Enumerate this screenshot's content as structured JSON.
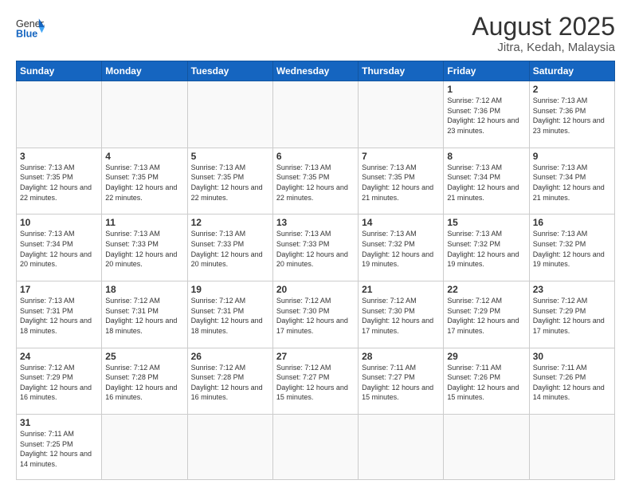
{
  "logo": {
    "text_general": "General",
    "text_blue": "Blue"
  },
  "header": {
    "month_year": "August 2025",
    "location": "Jitra, Kedah, Malaysia"
  },
  "weekdays": [
    "Sunday",
    "Monday",
    "Tuesday",
    "Wednesday",
    "Thursday",
    "Friday",
    "Saturday"
  ],
  "weeks": [
    [
      {
        "day": "",
        "info": ""
      },
      {
        "day": "",
        "info": ""
      },
      {
        "day": "",
        "info": ""
      },
      {
        "day": "",
        "info": ""
      },
      {
        "day": "",
        "info": ""
      },
      {
        "day": "1",
        "info": "Sunrise: 7:12 AM\nSunset: 7:36 PM\nDaylight: 12 hours\nand 23 minutes."
      },
      {
        "day": "2",
        "info": "Sunrise: 7:13 AM\nSunset: 7:36 PM\nDaylight: 12 hours\nand 23 minutes."
      }
    ],
    [
      {
        "day": "3",
        "info": "Sunrise: 7:13 AM\nSunset: 7:35 PM\nDaylight: 12 hours\nand 22 minutes."
      },
      {
        "day": "4",
        "info": "Sunrise: 7:13 AM\nSunset: 7:35 PM\nDaylight: 12 hours\nand 22 minutes."
      },
      {
        "day": "5",
        "info": "Sunrise: 7:13 AM\nSunset: 7:35 PM\nDaylight: 12 hours\nand 22 minutes."
      },
      {
        "day": "6",
        "info": "Sunrise: 7:13 AM\nSunset: 7:35 PM\nDaylight: 12 hours\nand 22 minutes."
      },
      {
        "day": "7",
        "info": "Sunrise: 7:13 AM\nSunset: 7:35 PM\nDaylight: 12 hours\nand 21 minutes."
      },
      {
        "day": "8",
        "info": "Sunrise: 7:13 AM\nSunset: 7:34 PM\nDaylight: 12 hours\nand 21 minutes."
      },
      {
        "day": "9",
        "info": "Sunrise: 7:13 AM\nSunset: 7:34 PM\nDaylight: 12 hours\nand 21 minutes."
      }
    ],
    [
      {
        "day": "10",
        "info": "Sunrise: 7:13 AM\nSunset: 7:34 PM\nDaylight: 12 hours\nand 20 minutes."
      },
      {
        "day": "11",
        "info": "Sunrise: 7:13 AM\nSunset: 7:33 PM\nDaylight: 12 hours\nand 20 minutes."
      },
      {
        "day": "12",
        "info": "Sunrise: 7:13 AM\nSunset: 7:33 PM\nDaylight: 12 hours\nand 20 minutes."
      },
      {
        "day": "13",
        "info": "Sunrise: 7:13 AM\nSunset: 7:33 PM\nDaylight: 12 hours\nand 20 minutes."
      },
      {
        "day": "14",
        "info": "Sunrise: 7:13 AM\nSunset: 7:32 PM\nDaylight: 12 hours\nand 19 minutes."
      },
      {
        "day": "15",
        "info": "Sunrise: 7:13 AM\nSunset: 7:32 PM\nDaylight: 12 hours\nand 19 minutes."
      },
      {
        "day": "16",
        "info": "Sunrise: 7:13 AM\nSunset: 7:32 PM\nDaylight: 12 hours\nand 19 minutes."
      }
    ],
    [
      {
        "day": "17",
        "info": "Sunrise: 7:13 AM\nSunset: 7:31 PM\nDaylight: 12 hours\nand 18 minutes."
      },
      {
        "day": "18",
        "info": "Sunrise: 7:12 AM\nSunset: 7:31 PM\nDaylight: 12 hours\nand 18 minutes."
      },
      {
        "day": "19",
        "info": "Sunrise: 7:12 AM\nSunset: 7:31 PM\nDaylight: 12 hours\nand 18 minutes."
      },
      {
        "day": "20",
        "info": "Sunrise: 7:12 AM\nSunset: 7:30 PM\nDaylight: 12 hours\nand 17 minutes."
      },
      {
        "day": "21",
        "info": "Sunrise: 7:12 AM\nSunset: 7:30 PM\nDaylight: 12 hours\nand 17 minutes."
      },
      {
        "day": "22",
        "info": "Sunrise: 7:12 AM\nSunset: 7:29 PM\nDaylight: 12 hours\nand 17 minutes."
      },
      {
        "day": "23",
        "info": "Sunrise: 7:12 AM\nSunset: 7:29 PM\nDaylight: 12 hours\nand 17 minutes."
      }
    ],
    [
      {
        "day": "24",
        "info": "Sunrise: 7:12 AM\nSunset: 7:29 PM\nDaylight: 12 hours\nand 16 minutes."
      },
      {
        "day": "25",
        "info": "Sunrise: 7:12 AM\nSunset: 7:28 PM\nDaylight: 12 hours\nand 16 minutes."
      },
      {
        "day": "26",
        "info": "Sunrise: 7:12 AM\nSunset: 7:28 PM\nDaylight: 12 hours\nand 16 minutes."
      },
      {
        "day": "27",
        "info": "Sunrise: 7:12 AM\nSunset: 7:27 PM\nDaylight: 12 hours\nand 15 minutes."
      },
      {
        "day": "28",
        "info": "Sunrise: 7:11 AM\nSunset: 7:27 PM\nDaylight: 12 hours\nand 15 minutes."
      },
      {
        "day": "29",
        "info": "Sunrise: 7:11 AM\nSunset: 7:26 PM\nDaylight: 12 hours\nand 15 minutes."
      },
      {
        "day": "30",
        "info": "Sunrise: 7:11 AM\nSunset: 7:26 PM\nDaylight: 12 hours\nand 14 minutes."
      }
    ],
    [
      {
        "day": "31",
        "info": "Sunrise: 7:11 AM\nSunset: 7:25 PM\nDaylight: 12 hours\nand 14 minutes."
      },
      {
        "day": "",
        "info": ""
      },
      {
        "day": "",
        "info": ""
      },
      {
        "day": "",
        "info": ""
      },
      {
        "day": "",
        "info": ""
      },
      {
        "day": "",
        "info": ""
      },
      {
        "day": "",
        "info": ""
      }
    ]
  ]
}
